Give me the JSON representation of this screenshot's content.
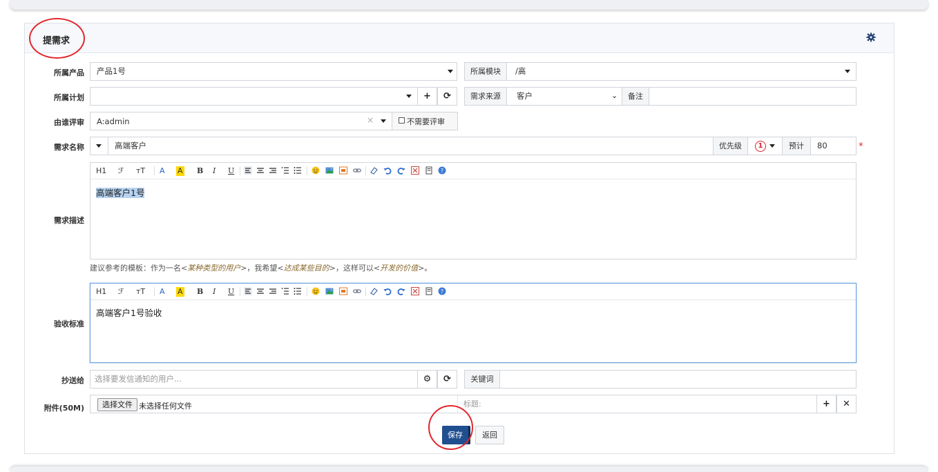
{
  "panel": {
    "title": "提需求"
  },
  "form": {
    "product_label": "所属产品",
    "product_value": "产品1号",
    "module_label": "所属模块",
    "module_value": "/高",
    "plan_label": "所属计划",
    "plan_value": "",
    "source_label": "需求来源",
    "source_value": "客户",
    "note_label": "备注",
    "reviewer_label": "由谁评审",
    "reviewer_value": "A:admin",
    "no_review_label": "不需要评审",
    "title_label": "需求名称",
    "title_value": "高端客户",
    "priority_label": "优先级",
    "priority_value": "1",
    "estimate_label": "预计",
    "estimate_value": "80",
    "required_mark": "*",
    "desc_label": "需求描述",
    "desc_value": "高端客户1号",
    "hint_prefix": "建议参考的模板：作为一名<",
    "hint_user": "某种类型的用户",
    "hint_mid1": ">，我希望<",
    "hint_goal": "达成某些目的",
    "hint_mid2": ">，这样可以<",
    "hint_value": "开发的价值",
    "hint_suffix": ">。",
    "verify_label": "验收标准",
    "verify_value": "高端客户1号验收",
    "cc_label": "抄送给",
    "cc_placeholder": "选择要发信通知的用户...",
    "keyword_label": "关键词",
    "keyword_value": "",
    "attach_label": "附件(50M)",
    "file_button": "选择文件",
    "file_status": "未选择任何文件",
    "attach_title_placeholder": "标题:"
  },
  "toolbar": {
    "heading": "H1",
    "font": "ℱ",
    "size": "тT",
    "color": "A",
    "bg": "A",
    "bold": "B",
    "italic": "I",
    "underline": "U"
  },
  "actions": {
    "save": "保存",
    "back": "返回"
  },
  "colors": {
    "accent": "#1f4f8f",
    "required": "#d9232a",
    "highlight_ring": "#e2252b"
  }
}
